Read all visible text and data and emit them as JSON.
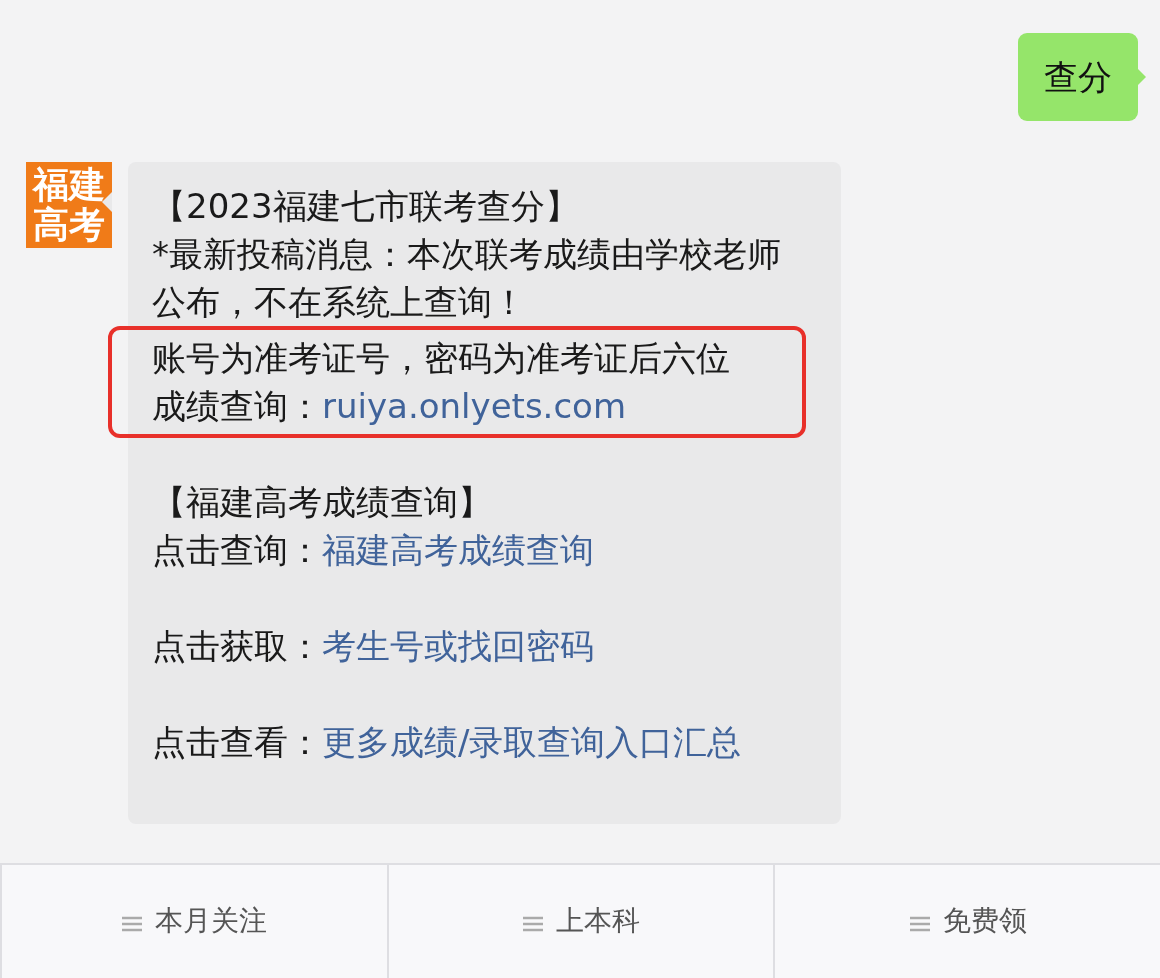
{
  "sent_message": {
    "text": "查分"
  },
  "received_message": {
    "avatar": {
      "lines": [
        "福建",
        "高考"
      ]
    },
    "blocks": [
      {
        "highlighted": false,
        "lines": [
          {
            "text": "【2023福建七市联考查分】"
          },
          {
            "text": "*最新投稿消息：本次联考成绩由学校老师公布，不在系统上查询！"
          }
        ]
      },
      {
        "highlighted": true,
        "lines": [
          {
            "text": "账号为准考证号，密码为准考证后六位"
          },
          {
            "text": "成绩查询：",
            "link": "ruiya.onlyets.com"
          }
        ]
      },
      {
        "highlighted": false,
        "lines": [
          {
            "text": "【福建高考成绩查询】"
          },
          {
            "text": "点击查询：",
            "link": "福建高考成绩查询"
          }
        ]
      },
      {
        "highlighted": false,
        "lines": [
          {
            "text": "点击获取：",
            "link": "考生号或找回密码"
          }
        ]
      },
      {
        "highlighted": false,
        "lines": [
          {
            "text": "点击查看：",
            "link": "更多成绩/录取查询入口汇总"
          }
        ]
      }
    ]
  },
  "menu": [
    {
      "label": "本月关注"
    },
    {
      "label": "上本科"
    },
    {
      "label": "免费领"
    }
  ]
}
